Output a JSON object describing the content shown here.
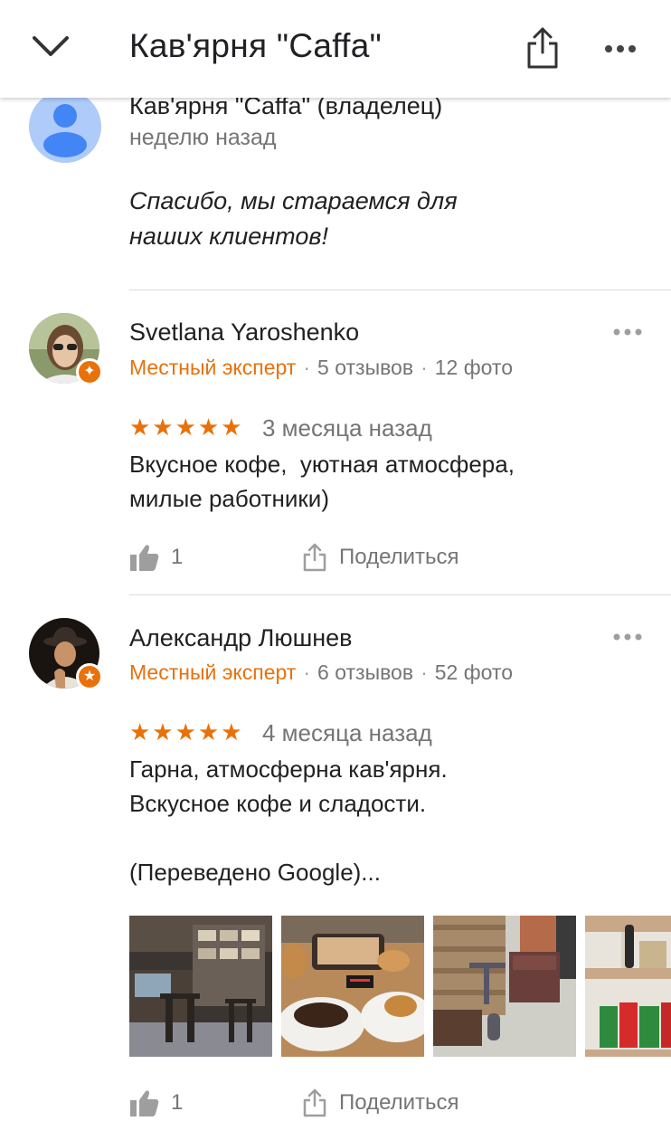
{
  "header": {
    "title": "Кав'ярня \"Caffa\""
  },
  "owner_reply": {
    "name": "Кав'ярня \"Caffa\" (владелец)",
    "time": "неделю назад",
    "text": "Спасибо, мы стараемся для наших клиентов!"
  },
  "reviews": [
    {
      "name": "Svetlana Yaroshenko",
      "badge": "Местный эксперт",
      "review_count": "5 отзывов",
      "photo_count": "12 фото",
      "stars": "★★★★★",
      "rating": 5,
      "time": "3 месяца назад",
      "text": "Вкусное кофе,  уютная атмосфера,\nмилые работники)",
      "likes": "1",
      "share_label": "Поделиться"
    },
    {
      "name": "Александр Люшнев",
      "badge": "Местный эксперт",
      "review_count": "6 отзывов",
      "photo_count": "52 фото",
      "stars": "★★★★★",
      "rating": 5,
      "time": "4 месяца назад",
      "text": "Гарна, атмосферна кав'ярня.\nВскусное кофе и сладости.\n\n(Переведено Google)...",
      "likes": "1",
      "share_label": "Поделиться",
      "photos": [
        "cafe-interior-photo",
        "pastries-photo",
        "pallet-furniture-photo",
        "shelf-products-photo"
      ]
    }
  ],
  "colors": {
    "accent": "#e8710a",
    "secondary_text": "#757575",
    "owner_avatar": "#aecbfa",
    "owner_avatar_icon": "#4285f4",
    "divider": "#dadce0"
  }
}
